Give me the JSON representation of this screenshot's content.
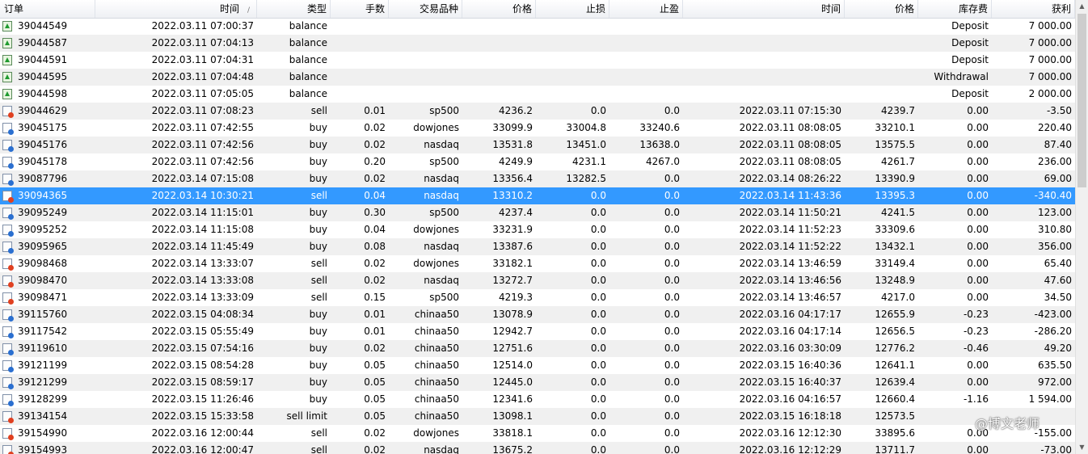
{
  "columns": [
    "订单",
    "时间",
    "类型",
    "手数",
    "交易品种",
    "价格",
    "止损",
    "止盈",
    "时间",
    "价格",
    "库存费",
    "获利"
  ],
  "rows": [
    {
      "kind": "balance",
      "order": "39044549",
      "open_time": "2022.03.11 07:00:37",
      "type": "balance",
      "size": "",
      "symbol": "",
      "price": "",
      "sl": "",
      "tp": "",
      "close_time": "",
      "close_price": "",
      "swap": "Deposit",
      "profit": "7 000.00"
    },
    {
      "kind": "balance",
      "order": "39044587",
      "open_time": "2022.03.11 07:04:13",
      "type": "balance",
      "size": "",
      "symbol": "",
      "price": "",
      "sl": "",
      "tp": "",
      "close_time": "",
      "close_price": "",
      "swap": "Deposit",
      "profit": "7 000.00"
    },
    {
      "kind": "balance",
      "order": "39044591",
      "open_time": "2022.03.11 07:04:31",
      "type": "balance",
      "size": "",
      "symbol": "",
      "price": "",
      "sl": "",
      "tp": "",
      "close_time": "",
      "close_price": "",
      "swap": "Deposit",
      "profit": "7 000.00"
    },
    {
      "kind": "balance",
      "order": "39044595",
      "open_time": "2022.03.11 07:04:48",
      "type": "balance",
      "size": "",
      "symbol": "",
      "price": "",
      "sl": "",
      "tp": "",
      "close_time": "",
      "close_price": "",
      "swap": "Withdrawal",
      "profit": "7 000.00"
    },
    {
      "kind": "balance",
      "order": "39044598",
      "open_time": "2022.03.11 07:05:05",
      "type": "balance",
      "size": "",
      "symbol": "",
      "price": "",
      "sl": "",
      "tp": "",
      "close_time": "",
      "close_price": "",
      "swap": "Deposit",
      "profit": "2 000.00"
    },
    {
      "kind": "sell",
      "order": "39044629",
      "open_time": "2022.03.11 07:08:23",
      "type": "sell",
      "size": "0.01",
      "symbol": "sp500",
      "price": "4236.2",
      "sl": "0.0",
      "tp": "0.0",
      "close_time": "2022.03.11 07:15:30",
      "close_price": "4239.7",
      "swap": "0.00",
      "profit": "-3.50"
    },
    {
      "kind": "buy",
      "order": "39045175",
      "open_time": "2022.03.11 07:42:55",
      "type": "buy",
      "size": "0.02",
      "symbol": "dowjones",
      "price": "33099.9",
      "sl": "33004.8",
      "tp": "33240.6",
      "close_time": "2022.03.11 08:08:05",
      "close_price": "33210.1",
      "swap": "0.00",
      "profit": "220.40"
    },
    {
      "kind": "buy",
      "order": "39045176",
      "open_time": "2022.03.11 07:42:56",
      "type": "buy",
      "size": "0.02",
      "symbol": "nasdaq",
      "price": "13531.8",
      "sl": "13451.0",
      "tp": "13638.0",
      "close_time": "2022.03.11 08:08:05",
      "close_price": "13575.5",
      "swap": "0.00",
      "profit": "87.40"
    },
    {
      "kind": "buy",
      "order": "39045178",
      "open_time": "2022.03.11 07:42:56",
      "type": "buy",
      "size": "0.20",
      "symbol": "sp500",
      "price": "4249.9",
      "sl": "4231.1",
      "tp": "4267.0",
      "close_time": "2022.03.11 08:08:05",
      "close_price": "4261.7",
      "swap": "0.00",
      "profit": "236.00"
    },
    {
      "kind": "buy",
      "order": "39087796",
      "open_time": "2022.03.14 07:15:08",
      "type": "buy",
      "size": "0.02",
      "symbol": "nasdaq",
      "price": "13356.4",
      "sl": "13282.5",
      "tp": "0.0",
      "close_time": "2022.03.14 08:26:22",
      "close_price": "13390.9",
      "swap": "0.00",
      "profit": "69.00"
    },
    {
      "kind": "sell",
      "order": "39094365",
      "open_time": "2022.03.14 10:30:21",
      "type": "sell",
      "size": "0.04",
      "symbol": "nasdaq",
      "price": "13310.2",
      "sl": "0.0",
      "tp": "0.0",
      "close_time": "2022.03.14 11:43:36",
      "close_price": "13395.3",
      "swap": "0.00",
      "profit": "-340.40",
      "selected": true
    },
    {
      "kind": "buy",
      "order": "39095249",
      "open_time": "2022.03.14 11:15:01",
      "type": "buy",
      "size": "0.30",
      "symbol": "sp500",
      "price": "4237.4",
      "sl": "0.0",
      "tp": "0.0",
      "close_time": "2022.03.14 11:50:21",
      "close_price": "4241.5",
      "swap": "0.00",
      "profit": "123.00"
    },
    {
      "kind": "buy",
      "order": "39095252",
      "open_time": "2022.03.14 11:15:08",
      "type": "buy",
      "size": "0.04",
      "symbol": "dowjones",
      "price": "33231.9",
      "sl": "0.0",
      "tp": "0.0",
      "close_time": "2022.03.14 11:52:23",
      "close_price": "33309.6",
      "swap": "0.00",
      "profit": "310.80"
    },
    {
      "kind": "buy",
      "order": "39095965",
      "open_time": "2022.03.14 11:45:49",
      "type": "buy",
      "size": "0.08",
      "symbol": "nasdaq",
      "price": "13387.6",
      "sl": "0.0",
      "tp": "0.0",
      "close_time": "2022.03.14 11:52:22",
      "close_price": "13432.1",
      "swap": "0.00",
      "profit": "356.00"
    },
    {
      "kind": "sell",
      "order": "39098468",
      "open_time": "2022.03.14 13:33:07",
      "type": "sell",
      "size": "0.02",
      "symbol": "dowjones",
      "price": "33182.1",
      "sl": "0.0",
      "tp": "0.0",
      "close_time": "2022.03.14 13:46:59",
      "close_price": "33149.4",
      "swap": "0.00",
      "profit": "65.40"
    },
    {
      "kind": "sell",
      "order": "39098470",
      "open_time": "2022.03.14 13:33:08",
      "type": "sell",
      "size": "0.02",
      "symbol": "nasdaq",
      "price": "13272.7",
      "sl": "0.0",
      "tp": "0.0",
      "close_time": "2022.03.14 13:46:56",
      "close_price": "13248.9",
      "swap": "0.00",
      "profit": "47.60"
    },
    {
      "kind": "sell",
      "order": "39098471",
      "open_time": "2022.03.14 13:33:09",
      "type": "sell",
      "size": "0.15",
      "symbol": "sp500",
      "price": "4219.3",
      "sl": "0.0",
      "tp": "0.0",
      "close_time": "2022.03.14 13:46:57",
      "close_price": "4217.0",
      "swap": "0.00",
      "profit": "34.50"
    },
    {
      "kind": "buy",
      "order": "39115760",
      "open_time": "2022.03.15 04:08:34",
      "type": "buy",
      "size": "0.01",
      "symbol": "chinaa50",
      "price": "13078.9",
      "sl": "0.0",
      "tp": "0.0",
      "close_time": "2022.03.16 04:17:17",
      "close_price": "12655.9",
      "swap": "-0.23",
      "profit": "-423.00"
    },
    {
      "kind": "buy",
      "order": "39117542",
      "open_time": "2022.03.15 05:55:49",
      "type": "buy",
      "size": "0.01",
      "symbol": "chinaa50",
      "price": "12942.7",
      "sl": "0.0",
      "tp": "0.0",
      "close_time": "2022.03.16 04:17:14",
      "close_price": "12656.5",
      "swap": "-0.23",
      "profit": "-286.20"
    },
    {
      "kind": "buy",
      "order": "39119610",
      "open_time": "2022.03.15 07:54:16",
      "type": "buy",
      "size": "0.02",
      "symbol": "chinaa50",
      "price": "12751.6",
      "sl": "0.0",
      "tp": "0.0",
      "close_time": "2022.03.16 03:30:09",
      "close_price": "12776.2",
      "swap": "-0.46",
      "profit": "49.20"
    },
    {
      "kind": "buy",
      "order": "39121199",
      "open_time": "2022.03.15 08:54:28",
      "type": "buy",
      "size": "0.05",
      "symbol": "chinaa50",
      "price": "12514.0",
      "sl": "0.0",
      "tp": "0.0",
      "close_time": "2022.03.15 16:40:36",
      "close_price": "12641.1",
      "swap": "0.00",
      "profit": "635.50"
    },
    {
      "kind": "buy",
      "order": "39121299",
      "open_time": "2022.03.15 08:59:17",
      "type": "buy",
      "size": "0.05",
      "symbol": "chinaa50",
      "price": "12445.0",
      "sl": "0.0",
      "tp": "0.0",
      "close_time": "2022.03.15 16:40:37",
      "close_price": "12639.4",
      "swap": "0.00",
      "profit": "972.00"
    },
    {
      "kind": "buy",
      "order": "39128299",
      "open_time": "2022.03.15 11:26:46",
      "type": "buy",
      "size": "0.05",
      "symbol": "chinaa50",
      "price": "12341.6",
      "sl": "0.0",
      "tp": "0.0",
      "close_time": "2022.03.16 04:16:57",
      "close_price": "12660.4",
      "swap": "-1.16",
      "profit": "1 594.00"
    },
    {
      "kind": "sell",
      "order": "39134154",
      "open_time": "2022.03.15 15:33:58",
      "type": "sell limit",
      "size": "0.05",
      "symbol": "chinaa50",
      "price": "13098.1",
      "sl": "0.0",
      "tp": "0.0",
      "close_time": "2022.03.15 16:18:18",
      "close_price": "12573.5",
      "swap": "",
      "profit": ""
    },
    {
      "kind": "sell",
      "order": "39154990",
      "open_time": "2022.03.16 12:00:44",
      "type": "sell",
      "size": "0.02",
      "symbol": "dowjones",
      "price": "33818.1",
      "sl": "0.0",
      "tp": "0.0",
      "close_time": "2022.03.16 12:12:30",
      "close_price": "33895.6",
      "swap": "0.00",
      "profit": "-155.00"
    },
    {
      "kind": "sell",
      "order": "39154993",
      "open_time": "2022.03.16 12:00:47",
      "type": "sell",
      "size": "0.02",
      "symbol": "nasdaq",
      "price": "13675.2",
      "sl": "0.0",
      "tp": "0.0",
      "close_time": "2022.03.16 12:12:29",
      "close_price": "13711.7",
      "swap": "0.00",
      "profit": "-73.00"
    }
  ],
  "watermark": "@博文老师",
  "sort_indicator": "/"
}
